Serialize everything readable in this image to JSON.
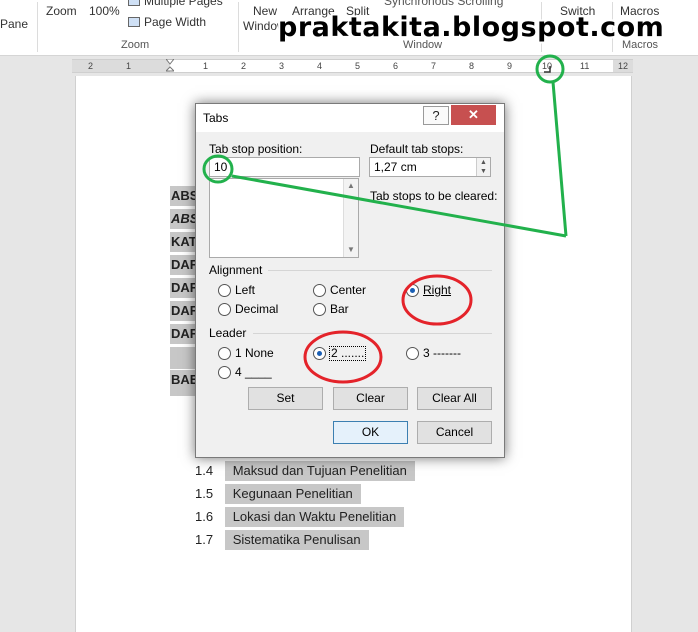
{
  "ribbon": {
    "pane_label": "Pane",
    "zoom_label": "Zoom",
    "zoom_percent": "100%",
    "multiple_pages": "Multiple Pages",
    "page_width": "Page Width",
    "zoom_group": "Zoom",
    "new_label": "New",
    "window_label": "Window",
    "arrange_label": "Arrange",
    "split_label": "Split",
    "sync_scrolling": "Synchronous Scrolling",
    "window_group": "Window",
    "switch_label": "Switch",
    "macros_label": "Macros",
    "macros_group": "Macros"
  },
  "watermark": "praktakita.blogspot.com",
  "ruler": {
    "numbers": [
      "2",
      "1",
      "1",
      "2",
      "3",
      "4",
      "5",
      "6",
      "7",
      "8",
      "9",
      "10",
      "11",
      "12"
    ]
  },
  "document": {
    "cut_fragments": [
      "ABS",
      "ABS",
      "KAT",
      "DAF",
      "DAF",
      "DAF",
      "DAF",
      "BAE"
    ],
    "items": [
      {
        "num": "1.4",
        "text": "Maksud dan Tujuan Penelitian"
      },
      {
        "num": "1.5",
        "text": "Kegunaan Penelitian"
      },
      {
        "num": "1.6",
        "text": "Lokasi dan Waktu Penelitian"
      },
      {
        "num": "1.7",
        "text": "Sistematika Penulisan"
      }
    ]
  },
  "dialog": {
    "title": "Tabs",
    "help": "?",
    "close": "✕",
    "tab_stop_position_label": "Tab stop position:",
    "tab_stop_position_value": "10",
    "default_tab_stops_label": "Default tab stops:",
    "default_tab_stops_value": "1,27 cm",
    "tab_stops_to_clear_label": "Tab stops to be cleared:",
    "alignment_label": "Alignment",
    "alignment_options": [
      "Left",
      "Center",
      "Right",
      "Decimal",
      "Bar"
    ],
    "alignment_selected": "Right",
    "leader_label": "Leader",
    "leader_options": [
      "1 None",
      "2 .......",
      "3 -------",
      "4 ____"
    ],
    "leader_selected": "2 .......",
    "buttons": {
      "set": "Set",
      "clear": "Clear",
      "clear_all": "Clear All",
      "ok": "OK",
      "cancel": "Cancel"
    }
  },
  "colors": {
    "annotation_green": "#22b14c",
    "annotation_red": "#e4232a",
    "close_red": "#c75050",
    "highlight_gray": "#c7c7c7"
  }
}
